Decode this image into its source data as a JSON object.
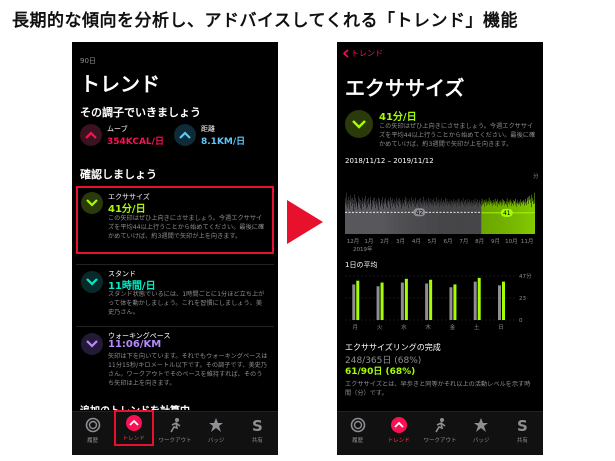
{
  "headline": "長期的な傾向を分析し、アドバイスしてくれる「トレンド」機能",
  "left": {
    "period": "90日",
    "title": "トレンド",
    "keep_section": "その調子でいきましょう",
    "move": {
      "label": "ムーブ",
      "value": "354KCAL/日"
    },
    "distance": {
      "label": "距離",
      "value": "8.1KM/日"
    },
    "check_section": "確認しましょう",
    "exercise": {
      "label": "エクササイズ",
      "value": "41分/日",
      "desc": "この矢印はぜひ上向きにさせましょう。今週エクササイズを平均44以上行うことから始めてください。最後に確かめていけば、約3週間で矢印が上を向きます。"
    },
    "stand": {
      "label": "スタンド",
      "value": "11時間/日",
      "desc": "スタンド状態でいるには、1時間ごとに1分ほど立ち上がって体を動かしましょう。これを習慣にしましょう、美史乃さん。"
    },
    "walk": {
      "label": "ウォーキングペース",
      "value": "11:06/KM",
      "desc": "矢印は下を向いています。それでもウォーキングペースは11分15秒/キロメートル以下です。その調子です、美史乃さん。ワークアウトでそのペースを維持すれば、そのうち矢印は上を向きます。"
    },
    "cut_text": "追加のトレンドを計算中"
  },
  "tabs": [
    {
      "label": "履歴",
      "icon": "history-icon"
    },
    {
      "label": "トレンド",
      "icon": "trend-icon"
    },
    {
      "label": "ワークアウト",
      "icon": "workout-icon"
    },
    {
      "label": "バッジ",
      "icon": "badge-icon"
    },
    {
      "label": "共有",
      "icon": "share-icon"
    }
  ],
  "right": {
    "back": "トレンド",
    "title": "エクササイズ",
    "value": "41分/日",
    "desc": "この矢印はぜひ上向きにさせましょう。今週エクササイズを平均44以上行うことから始めてください。最後に確かめていけば、約3週間で矢印が上を向きます。",
    "range": "2018/11/12 – 2019/11/12",
    "avg_old": "42",
    "avg_new": "41",
    "daily_title": "1日の平均",
    "ring_title": "エクササイズリングの完成",
    "ring_year": "248/365日 (68%)",
    "ring_90": "61/90日 (68%)",
    "footer": "エクササイズとは、早歩きと同等かそれ以上の活動レベルを示す時間（分）です。"
  },
  "chart_data": [
    {
      "type": "bar",
      "title": "",
      "categories": [
        "12月",
        "1月",
        "2月",
        "3月",
        "4月",
        "5月",
        "6月",
        "7月",
        "8月",
        "9月",
        "10月",
        "11月"
      ],
      "year_label": "2019年",
      "ylim": [
        0,
        120
      ],
      "ytick_top": "分",
      "reference_lines": [
        42,
        41
      ],
      "series": [
        {
          "values": [
            60,
            70,
            55,
            80,
            65,
            50,
            58,
            72,
            66,
            48,
            62,
            75,
            54,
            68,
            70,
            59,
            44,
            66,
            77,
            58,
            52,
            70,
            64,
            60,
            48,
            55,
            73,
            61,
            69,
            57,
            50,
            66,
            62,
            47,
            71,
            58,
            64,
            53,
            60,
            68,
            56,
            74,
            49,
            63,
            67,
            52,
            58,
            70,
            61,
            55,
            65,
            72,
            48,
            59,
            66,
            53,
            62,
            69,
            57,
            71,
            64,
            50,
            58,
            67,
            54,
            61,
            70,
            46,
            63,
            68,
            57,
            52,
            66,
            60,
            72,
            55,
            61,
            49,
            67,
            58,
            63,
            70,
            54,
            59,
            65,
            51,
            68,
            62,
            57,
            64,
            72,
            48,
            60,
            66,
            53,
            69,
            58,
            61,
            55,
            67,
            63,
            50,
            71,
            59,
            64,
            56,
            68,
            52,
            62,
            70,
            57,
            65,
            49,
            60,
            67,
            54,
            61,
            58,
            66,
            53,
            72,
            63,
            55,
            69,
            57,
            61,
            64,
            50,
            68,
            59,
            62,
            56,
            71,
            53,
            65,
            60,
            58,
            67,
            54,
            63,
            70,
            52,
            61,
            57,
            66,
            59,
            64,
            55,
            68,
            51,
            62,
            69,
            57,
            60,
            65,
            53,
            72,
            58,
            61,
            66,
            54,
            63,
            59,
            67,
            56,
            62,
            70,
            52,
            64,
            58,
            60,
            68,
            55,
            61,
            57,
            66,
            53,
            69,
            62,
            59,
            63,
            56,
            71,
            54,
            60,
            65,
            58,
            67,
            52,
            61,
            64,
            57,
            69,
            55,
            62,
            60,
            66,
            53,
            63,
            59,
            70,
            56,
            61,
            68,
            54,
            64,
            58,
            62,
            57,
            67,
            55,
            60,
            65,
            52,
            63,
            59,
            68,
            56,
            61,
            64,
            58,
            66,
            53,
            62,
            60,
            67,
            55,
            69,
            57,
            63,
            54,
            61,
            65,
            58,
            62,
            70,
            56,
            59,
            64,
            52,
            66,
            60,
            57,
            68,
            55,
            63,
            61,
            58,
            67,
            54,
            62,
            59,
            65,
            53,
            60,
            66,
            57,
            64,
            56,
            69,
            58,
            61,
            63,
            55,
            67,
            52,
            60,
            62,
            65,
            57,
            59,
            64,
            54,
            68,
            56,
            61,
            58,
            66,
            53,
            63,
            60,
            67,
            55,
            62,
            57,
            64,
            59,
            70,
            56,
            61,
            65,
            58,
            63,
            54,
            60,
            66,
            57,
            62,
            59,
            68,
            55,
            61,
            64,
            53,
            67,
            58,
            60,
            63,
            56,
            65,
            59,
            62,
            54,
            68,
            57,
            61,
            66,
            55,
            64,
            60,
            58,
            63,
            56,
            69,
            52,
            62,
            59,
            65,
            57,
            61,
            67,
            54,
            63,
            60,
            58,
            66,
            55,
            62,
            64,
            57,
            68,
            53,
            61,
            59,
            65,
            56,
            60,
            63,
            58,
            67,
            54,
            62,
            60,
            64,
            57,
            61,
            66,
            55,
            63,
            59,
            68,
            56,
            62,
            70,
            65,
            72,
            58,
            66,
            74,
            60,
            68,
            52,
            76,
            63,
            70,
            58,
            65,
            80,
            59
          ]
        }
      ]
    },
    {
      "type": "bar",
      "title": "1日の平均",
      "categories": [
        "月",
        "火",
        "水",
        "木",
        "金",
        "土",
        "日"
      ],
      "yticks": [
        "47分",
        "23",
        "0"
      ],
      "ylim": [
        0,
        47
      ],
      "series": [
        {
          "name": "year",
          "values": [
            38,
            36,
            40,
            39,
            35,
            41,
            37
          ]
        },
        {
          "name": "recent",
          "values": [
            42,
            40,
            44,
            43,
            38,
            45,
            41
          ]
        }
      ]
    }
  ],
  "colors": {
    "red": "#fa1155",
    "green": "#a6ff00",
    "blue": "#5ac8fa",
    "cyan": "#00f0c8",
    "purple": "#b78bff",
    "highlight": "#e8112d"
  }
}
